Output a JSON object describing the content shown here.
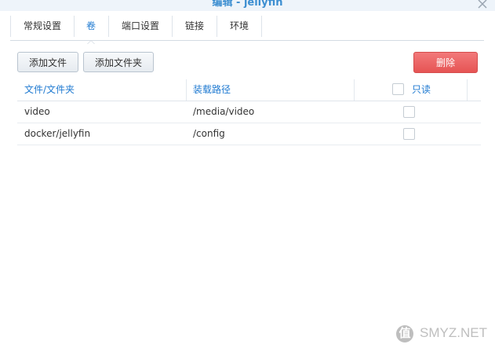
{
  "window": {
    "title": "编辑 - jellyfin"
  },
  "tabs": [
    {
      "label": "常规设置",
      "active": false
    },
    {
      "label": "卷",
      "active": true
    },
    {
      "label": "端口设置",
      "active": false
    },
    {
      "label": "链接",
      "active": false
    },
    {
      "label": "环境",
      "active": false
    }
  ],
  "toolbar": {
    "add_file_label": "添加文件",
    "add_folder_label": "添加文件夹",
    "delete_label": "删除"
  },
  "table": {
    "columns": [
      "文件/文件夹",
      "装载路径",
      "只读"
    ],
    "rows": [
      {
        "file": "video",
        "mount_path": "/media/video",
        "readonly": false
      },
      {
        "file": "docker/jellyfin",
        "mount_path": "/config",
        "readonly": false
      }
    ]
  },
  "watermark": {
    "text": "SMYZ.NET",
    "logo_glyph": "值"
  },
  "colors": {
    "accent": "#1f7ad1",
    "title": "#3d8fd1",
    "danger": "#e65454"
  }
}
